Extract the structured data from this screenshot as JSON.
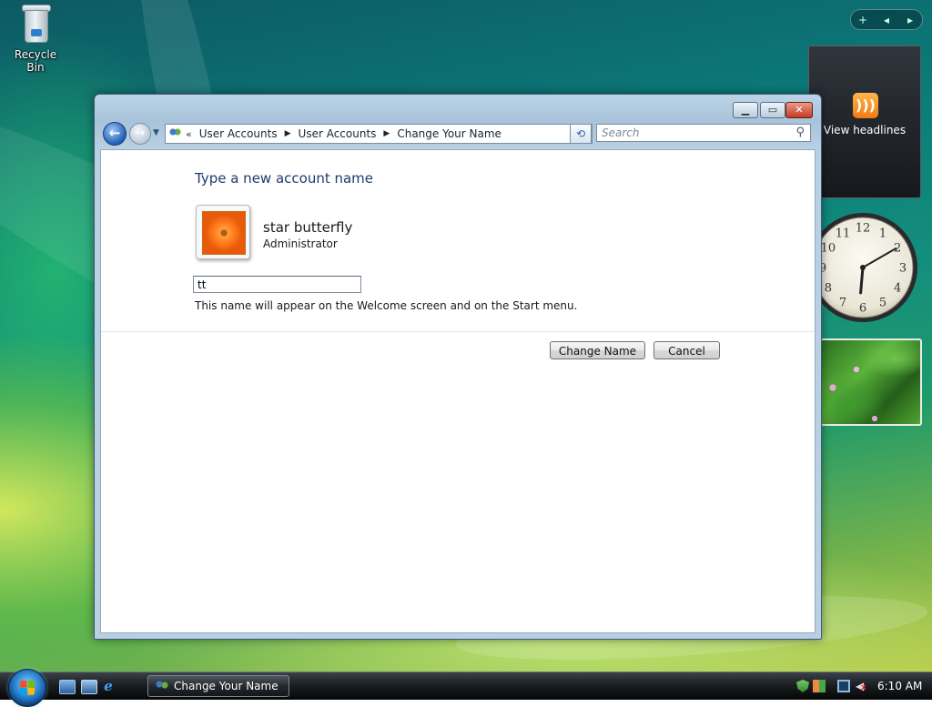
{
  "desktop": {
    "recycle_bin_label": "Recycle Bin"
  },
  "sidebar": {
    "controls": {
      "add": "+",
      "prev": "◂",
      "next": "▸"
    },
    "feed_label": "View headlines",
    "clock": {
      "hour": 6,
      "minute": 10
    }
  },
  "window": {
    "controls": {
      "minimize": "▁",
      "maximize": "▭",
      "close": "✕"
    },
    "nav": {
      "back": "←",
      "forward": "→",
      "recent": "▼"
    },
    "address": {
      "chevron": "«",
      "crumbs": [
        "User Accounts",
        "User Accounts",
        "Change Your Name"
      ],
      "separator": "▶",
      "dropdown": "▼"
    },
    "refresh": "⟲",
    "search": {
      "placeholder": "Search",
      "icon": "🔍"
    },
    "content": {
      "heading": "Type a new account name",
      "user_name": "star butterfly",
      "user_role": "Administrator",
      "name_input_value": "tt",
      "hint": "This name will appear on the Welcome screen and on the Start menu.",
      "change_button": "Change Name",
      "cancel_button": "Cancel"
    }
  },
  "taskbar": {
    "task_button_label": "Change Your Name",
    "ie_glyph": "e",
    "volume_glyph": "◀",
    "time": "6:10 AM"
  }
}
